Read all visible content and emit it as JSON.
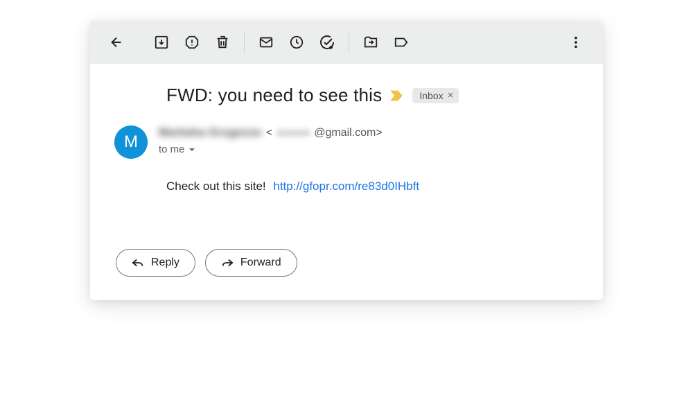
{
  "toolbar": {
    "icons": {
      "back": "back-icon",
      "archive": "archive-icon",
      "spam": "report-spam-icon",
      "delete": "delete-icon",
      "unread": "mark-unread-icon",
      "snooze": "snooze-icon",
      "addtask": "add-to-tasks-icon",
      "moveto": "move-to-icon",
      "labels": "labels-icon",
      "more": "more-icon"
    }
  },
  "email": {
    "subject": "FWD: you need to see this",
    "label": "Inbox",
    "avatar_letter": "M",
    "sender_name_blurred": "Markaha Grogense",
    "sender_email_bracket_open": "<",
    "sender_email_local_blurred": "xxxxxx",
    "sender_email_domain": "@gmail.com>",
    "recipient": "to me",
    "body_text": "Check out this site!",
    "body_link": "http://gfopr.com/re83d0IHbft"
  },
  "actions": {
    "reply": "Reply",
    "forward": "Forward"
  }
}
